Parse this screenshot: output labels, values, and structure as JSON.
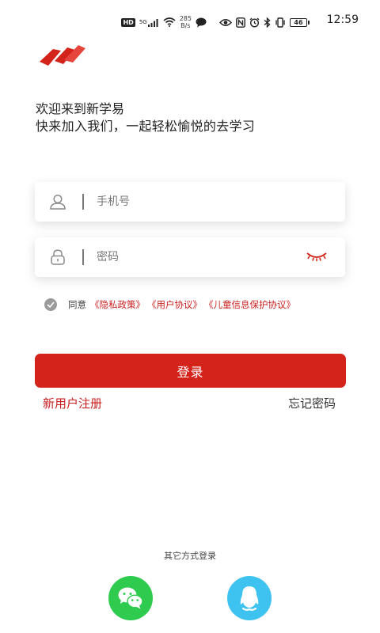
{
  "status_bar": {
    "hd_badge": "HD",
    "signal_label": "5G",
    "net_speed_value": "285",
    "net_speed_unit": "B/s",
    "battery_level": "46",
    "time": "12:59"
  },
  "welcome": {
    "title": "欢迎来到新学易",
    "subtitle": "快来加入我们，一起轻松愉悦的去学习"
  },
  "form": {
    "phone_placeholder": "手机号",
    "password_placeholder": "密码"
  },
  "agreement": {
    "prefix": "同意",
    "links": [
      "《隐私政策》",
      "《用户协议》",
      "《儿童信息保护协议》"
    ],
    "checked": true
  },
  "actions": {
    "login_label": "登录",
    "register_label": "新用户注册",
    "forgot_label": "忘记密码"
  },
  "other_login": {
    "label": "其它方式登录"
  },
  "colors": {
    "brand_red": "#d3231a",
    "link_red": "#c81e1e",
    "wechat_green": "#2ecb4f",
    "qq_blue": "#3ec2f0"
  },
  "icons": {
    "logo": "book-logo-icon",
    "phone_field": "user-icon",
    "password_field": "lock-icon",
    "password_toggle": "eye-closed-icon",
    "wechat": "wechat-icon",
    "qq": "qq-icon"
  }
}
